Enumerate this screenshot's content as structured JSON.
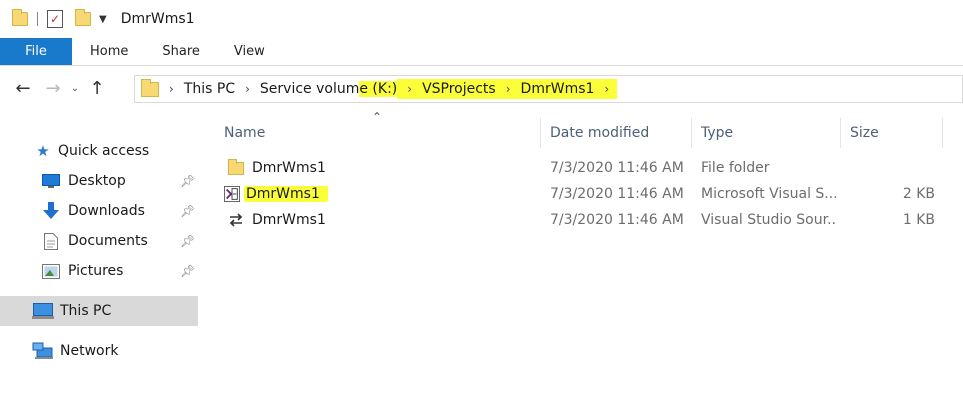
{
  "window": {
    "title": "DmrWms1"
  },
  "ribbon": {
    "tabs": [
      "File",
      "Home",
      "Share",
      "View"
    ]
  },
  "address": {
    "crumbs": [
      "This PC",
      "Service volume (K:)",
      "VSProjects",
      "DmrWms1"
    ]
  },
  "sidebar": {
    "quick_access": "Quick access",
    "items": [
      {
        "label": "Desktop",
        "icon": "desktop-icon"
      },
      {
        "label": "Downloads",
        "icon": "downloads-icon"
      },
      {
        "label": "Documents",
        "icon": "documents-icon"
      },
      {
        "label": "Pictures",
        "icon": "pictures-icon"
      }
    ],
    "this_pc": "This PC",
    "network": "Network"
  },
  "columns": {
    "name": "Name",
    "date": "Date modified",
    "type": "Type",
    "size": "Size"
  },
  "files": [
    {
      "name": "DmrWms1",
      "date": "7/3/2020 11:46 AM",
      "type": "File folder",
      "size": "",
      "icon": "folder-icon"
    },
    {
      "name": "DmrWms1",
      "date": "7/3/2020 11:46 AM",
      "type": "Microsoft Visual S...",
      "size": "2 KB",
      "icon": "vs-solution-icon"
    },
    {
      "name": "DmrWms1",
      "date": "7/3/2020 11:46 AM",
      "type": "Visual Studio Sour...",
      "size": "1 KB",
      "icon": "vs-source-control-icon"
    }
  ],
  "colors": {
    "accent": "#1979ca",
    "highlight": "#fbff3a",
    "selected": "#d9d9d9"
  }
}
